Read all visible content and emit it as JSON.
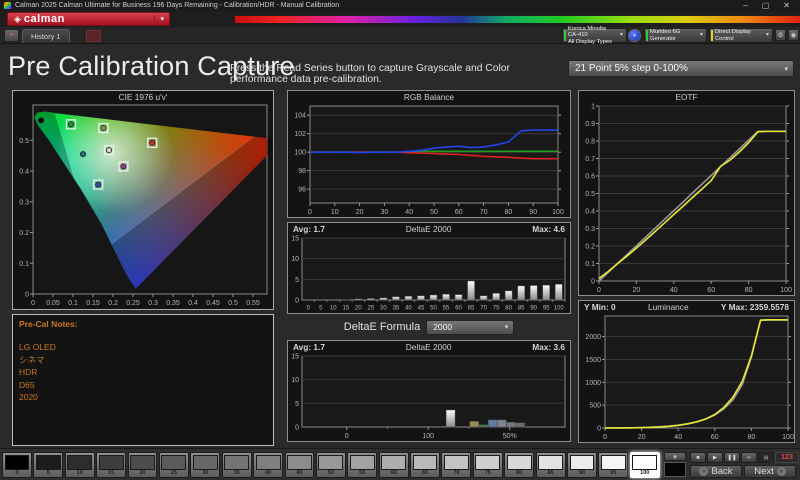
{
  "window": {
    "title": "Calman 2025 Calman Ultimate for Business 196 Days Remaining    - Calibration/HDR - Manual Calibration"
  },
  "brand": {
    "name": "calman"
  },
  "tabs": {
    "history": "History 1"
  },
  "toolbar": {
    "meter_line1": "Konica Minolta CA-410",
    "meter_line2": "All Display Types",
    "generator": "Murideo 6G Generator",
    "display_control": "Direct Display Control"
  },
  "header": {
    "title": "Pre Calibration Capture",
    "instruction": "Press the Read Series button to capture Grayscale and Color performance data pre-calibration.",
    "points_dropdown": "21 Point 5% step 0-100%"
  },
  "notes": {
    "title": "Pre-Cal Notes:",
    "lines": [
      "LG OLED",
      "シネマ",
      "HDR",
      "D65",
      "2020"
    ]
  },
  "delta_formula": {
    "label": "DeltaE Formula",
    "value": "2000"
  },
  "chart_data": [
    {
      "id": "cie",
      "type": "scatter",
      "title": "CIE 1976 u'v'",
      "xlim": [
        0,
        0.585
      ],
      "ylim": [
        0,
        0.615
      ],
      "xticks": [
        0,
        0.05,
        0.1,
        0.15,
        0.2,
        0.25,
        0.3,
        0.35,
        0.4,
        0.45,
        0.5,
        0.55
      ],
      "yticks": [
        0,
        0.1,
        0.2,
        0.3,
        0.4,
        0.5
      ],
      "gamut": "BT.2020",
      "points": [
        {
          "u": 0.02,
          "v": 0.565,
          "color": "#0a0a0a",
          "marker": "dot"
        },
        {
          "u": 0.095,
          "v": 0.552,
          "color": "#2f8f3f",
          "marker": "square"
        },
        {
          "u": 0.176,
          "v": 0.54,
          "color": "#8f8f4f",
          "marker": "square"
        },
        {
          "u": 0.19,
          "v": 0.468,
          "color": "#d8d8d8",
          "marker": "open-square"
        },
        {
          "u": 0.125,
          "v": 0.455,
          "color": "#2f6f6f",
          "marker": "dot"
        },
        {
          "u": 0.298,
          "v": 0.492,
          "color": "#cf2f2f",
          "marker": "square"
        },
        {
          "u": 0.226,
          "v": 0.415,
          "color": "#8f3f8f",
          "marker": "square"
        },
        {
          "u": 0.163,
          "v": 0.356,
          "color": "#3f4f9f",
          "marker": "square"
        }
      ]
    },
    {
      "id": "rgb",
      "type": "line",
      "title": "RGB Balance",
      "x": [
        0,
        5,
        10,
        15,
        20,
        25,
        30,
        35,
        40,
        45,
        50,
        55,
        60,
        65,
        70,
        75,
        80,
        85,
        90,
        95,
        100
      ],
      "xticks": [
        0,
        10,
        20,
        30,
        40,
        50,
        60,
        70,
        80,
        90,
        100
      ],
      "ylim": [
        94.5,
        105
      ],
      "yticks": [
        96,
        98,
        100,
        102,
        104
      ],
      "series": [
        {
          "name": "Green",
          "color": "#1f9e1f",
          "values": [
            100,
            100,
            100,
            100,
            100,
            100,
            100,
            100,
            100,
            100.1,
            100.1,
            100.1,
            100.1,
            100.1,
            100.1,
            100.1,
            100.1,
            100.1,
            100.1,
            100.1,
            100.1
          ]
        },
        {
          "name": "Red",
          "color": "#dd2222",
          "values": [
            100,
            100,
            100,
            100,
            100,
            100,
            100,
            100,
            99.95,
            99.9,
            99.85,
            99.8,
            99.75,
            99.65,
            99.55,
            99.5,
            99.45,
            99.35,
            99.3,
            99.3,
            99.3
          ]
        },
        {
          "name": "Blue",
          "color": "#2244ee",
          "values": [
            100,
            100,
            100,
            100,
            99.95,
            100,
            100,
            100,
            100.1,
            100.2,
            100.45,
            100.55,
            100.65,
            100.5,
            100.55,
            100.8,
            101.1,
            102.3,
            102.4,
            102.4,
            102.4
          ]
        }
      ]
    },
    {
      "id": "de_grayscale",
      "type": "bar",
      "title": "DeltaE 2000",
      "avg_label": "Avg: 1.7",
      "max_label": "Max: 4.6",
      "categories": [
        "0",
        "5",
        "10",
        "15",
        "20",
        "25",
        "30",
        "35",
        "40",
        "45",
        "50",
        "55",
        "60",
        "65",
        "70",
        "75",
        "80",
        "85",
        "90",
        "95",
        "100"
      ],
      "values": [
        0,
        0,
        0,
        0.1,
        0.25,
        0.35,
        0.5,
        0.8,
        0.9,
        1.0,
        1.2,
        1.4,
        1.3,
        4.6,
        1.0,
        1.6,
        2.2,
        3.4,
        3.5,
        3.6,
        3.8
      ],
      "ylim": [
        0,
        15
      ],
      "yticks": [
        0,
        5,
        10,
        15
      ]
    },
    {
      "id": "de_color",
      "type": "bar-positioned",
      "title": "DeltaE 2000",
      "avg_label": "Avg: 1.7",
      "max_label": "Max: 3.6",
      "ylim": [
        0,
        15
      ],
      "yticks": [
        0,
        5,
        10,
        15
      ],
      "xticks": [
        {
          "label": "0",
          "pos": 0.17
        },
        {
          "label": "100",
          "pos": 0.48
        },
        {
          "label": "50%",
          "pos": 0.79
        }
      ],
      "minor_ticks": [
        0.325,
        0.635
      ],
      "bars": [
        {
          "pos": 0.565,
          "value": 3.6,
          "color": "gradient-white"
        },
        {
          "pos": 0.655,
          "value": 1.2,
          "color": "#9a8a55"
        },
        {
          "pos": 0.69,
          "value": 0.5,
          "color": "#4e7a50"
        },
        {
          "pos": 0.725,
          "value": 1.5,
          "color": "#5f7d9d"
        },
        {
          "pos": 0.76,
          "value": 1.5,
          "color": "#7e868e"
        },
        {
          "pos": 0.795,
          "value": 1.0,
          "color": "#787878"
        },
        {
          "pos": 0.83,
          "value": 0.9,
          "color": "#6e6e6e"
        }
      ]
    },
    {
      "id": "eotf",
      "type": "line",
      "title": "EOTF",
      "x": [
        0,
        5,
        10,
        15,
        20,
        25,
        30,
        35,
        40,
        45,
        50,
        55,
        60,
        65,
        70,
        75,
        80,
        85,
        90,
        95,
        100
      ],
      "xticks": [
        0,
        20,
        40,
        60,
        80,
        100
      ],
      "ylim": [
        0,
        1
      ],
      "yticks": [
        0,
        0.1,
        0.2,
        0.3,
        0.4,
        0.5,
        0.6,
        0.7,
        0.8,
        0.9,
        1
      ],
      "series": [
        {
          "name": "Target",
          "color": "#9a9a9a",
          "values": [
            0,
            0.05,
            0.101,
            0.151,
            0.201,
            0.251,
            0.302,
            0.352,
            0.402,
            0.452,
            0.503,
            0.553,
            0.603,
            0.654,
            0.704,
            0.754,
            0.805,
            0.855,
            0.855,
            0.855,
            0.855
          ]
        },
        {
          "name": "Measured",
          "color": "#e8e832",
          "values": [
            0.015,
            0.055,
            0.1,
            0.143,
            0.188,
            0.235,
            0.283,
            0.331,
            0.38,
            0.428,
            0.477,
            0.525,
            0.574,
            0.655,
            0.69,
            0.737,
            0.79,
            0.853,
            0.855,
            0.855,
            0.855
          ]
        }
      ]
    },
    {
      "id": "luminance",
      "type": "line",
      "title": "Luminance",
      "y_min_label": "Y Min: 0",
      "y_max_label": "Y Max: 2359.5578",
      "x": [
        0,
        5,
        10,
        15,
        20,
        25,
        30,
        35,
        40,
        45,
        50,
        55,
        60,
        65,
        70,
        75,
        80,
        85,
        90,
        95,
        100
      ],
      "xticks": [
        0,
        20,
        40,
        60,
        80,
        100
      ],
      "ylim": [
        0,
        2450
      ],
      "yticks": [
        0,
        500,
        1000,
        1500,
        2000
      ],
      "series": [
        {
          "name": "Target",
          "color": "#9a9a9a",
          "values": [
            0,
            1,
            2,
            5,
            9,
            15,
            25,
            40,
            62,
            92,
            135,
            195,
            285,
            420,
            620,
            950,
            1550,
            2359,
            2362,
            2362,
            2362
          ]
        },
        {
          "name": "Measured",
          "color": "#e8e832",
          "values": [
            0,
            1,
            2,
            4,
            8,
            14,
            23,
            37,
            57,
            88,
            132,
            198,
            295,
            450,
            680,
            1020,
            1580,
            2359,
            2368,
            2368,
            2365
          ]
        }
      ]
    }
  ],
  "bottom": {
    "patches": [
      0,
      5,
      10,
      15,
      20,
      25,
      30,
      35,
      40,
      45,
      50,
      55,
      60,
      65,
      70,
      75,
      80,
      85,
      90,
      95,
      100
    ],
    "selected_patch": 100,
    "counter": "123",
    "back": "Back",
    "next": "Next"
  },
  "icons": {
    "minimize": "–",
    "maximize": "▢",
    "close": "✕",
    "dropdown": "▾",
    "diamond": "◈",
    "gear": "⚙",
    "scope": "◉",
    "menu_dot": "●",
    "meter_led": "✦",
    "stop": "■",
    "play": "▶",
    "pause": "❚❚",
    "loop": "∞",
    "grid": "▦",
    "back_arrow": "«",
    "next_arrow": "»",
    "radio": "◉"
  }
}
